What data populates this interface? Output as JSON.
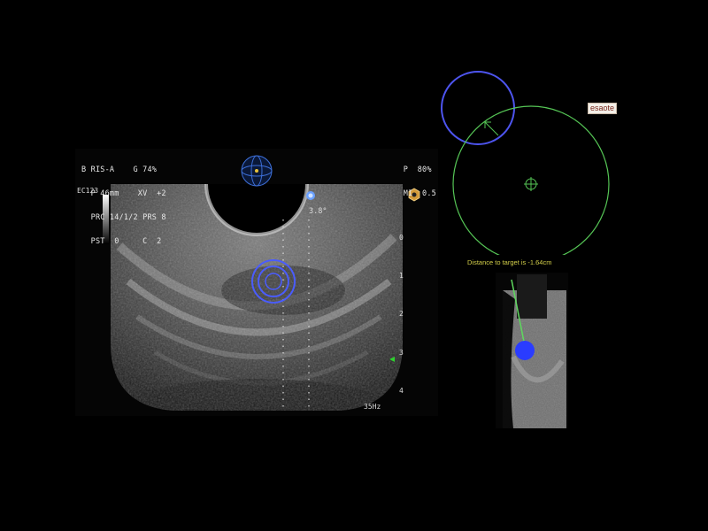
{
  "ultrasound": {
    "header_left": [
      "B RIS-A    G 74%",
      "  P 46mm    XV  +2",
      "  PRC 14/1/2 PRS 8",
      "  PST  0     C  2"
    ],
    "header_right": [
      "P  80%",
      "MI  0.5"
    ],
    "probe": "EC123",
    "angle": "3.8°",
    "frequency": "35Hz",
    "depth_marks": [
      "0",
      "1",
      "2",
      "3",
      "4"
    ]
  },
  "navigation": {
    "brand": "esaote",
    "distance_text": "Distance to target is -1.64cm"
  },
  "colors": {
    "target_circle": "#4a5cff",
    "nav_circle_blue": "#4d54ee",
    "nav_circle_green": "#55c455",
    "target_dot": "#2a3cff",
    "needle": "#5ed85e",
    "distance_text": "#d4d04a"
  }
}
